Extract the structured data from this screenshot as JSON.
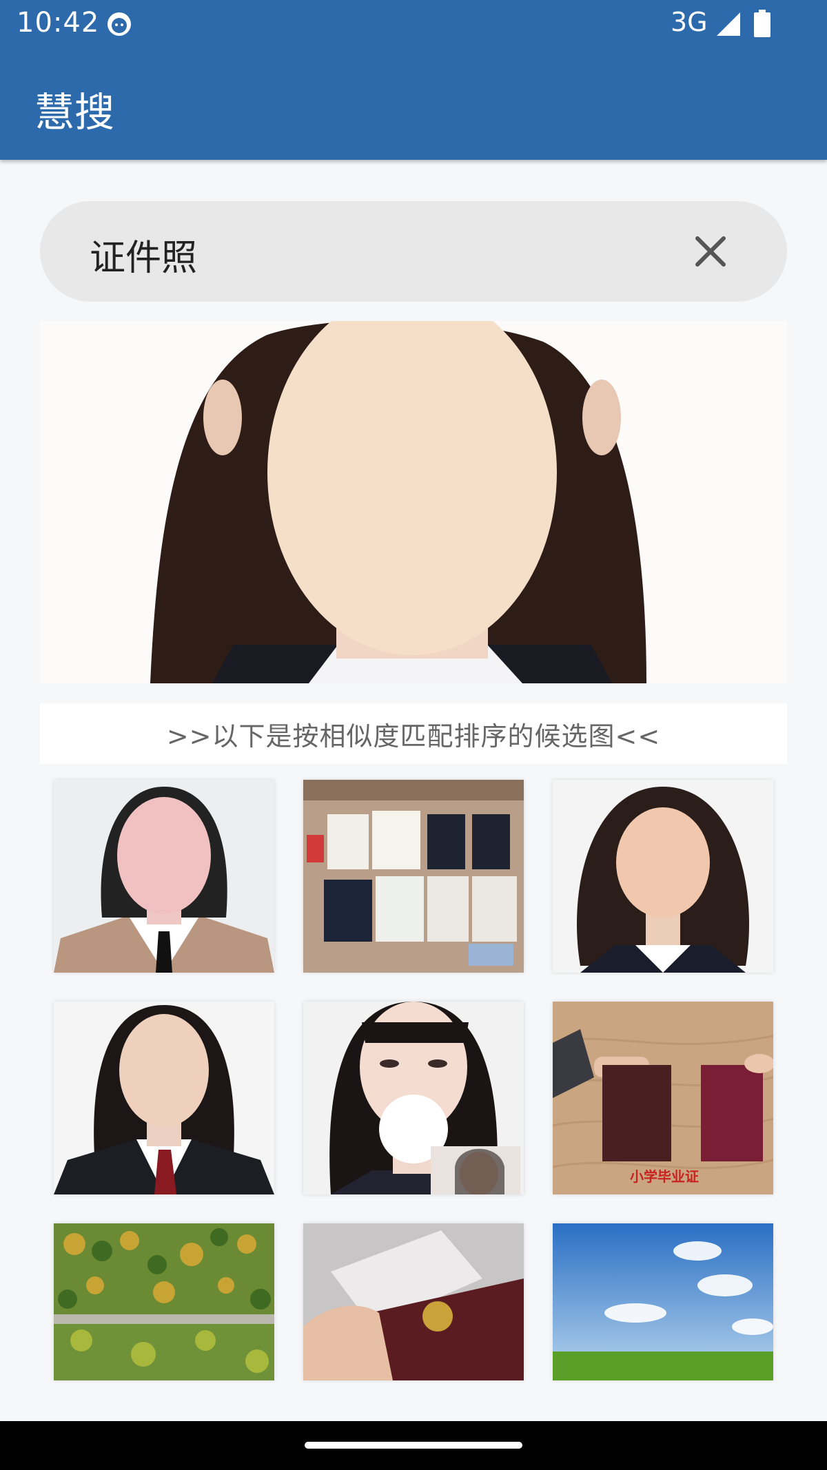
{
  "status_bar": {
    "time": "10:42",
    "network": "3G",
    "icons": [
      "app-notification-icon",
      "signal-icon",
      "battery-icon"
    ]
  },
  "app_bar": {
    "title": "慧搜"
  },
  "search": {
    "query": "证件照",
    "clear_icon": "close-icon"
  },
  "main_image": {
    "description_icon": "portrait-photo"
  },
  "results": {
    "caption": ">>以下是按相似度匹配排序的候选图<<",
    "thumbnails": [
      {
        "icon": "portrait-photo"
      },
      {
        "icon": "documents-photo"
      },
      {
        "icon": "portrait-photo"
      },
      {
        "icon": "portrait-photo"
      },
      {
        "icon": "portrait-photo"
      },
      {
        "icon": "certificates-photo",
        "overlay_text": "小学毕业证"
      },
      {
        "icon": "forest-photo"
      },
      {
        "icon": "id-card-photo"
      },
      {
        "icon": "sky-photo"
      }
    ]
  },
  "colors": {
    "primary": "#2c6aab",
    "background": "#f6f7f9",
    "search_bg": "#e8e8e8"
  }
}
